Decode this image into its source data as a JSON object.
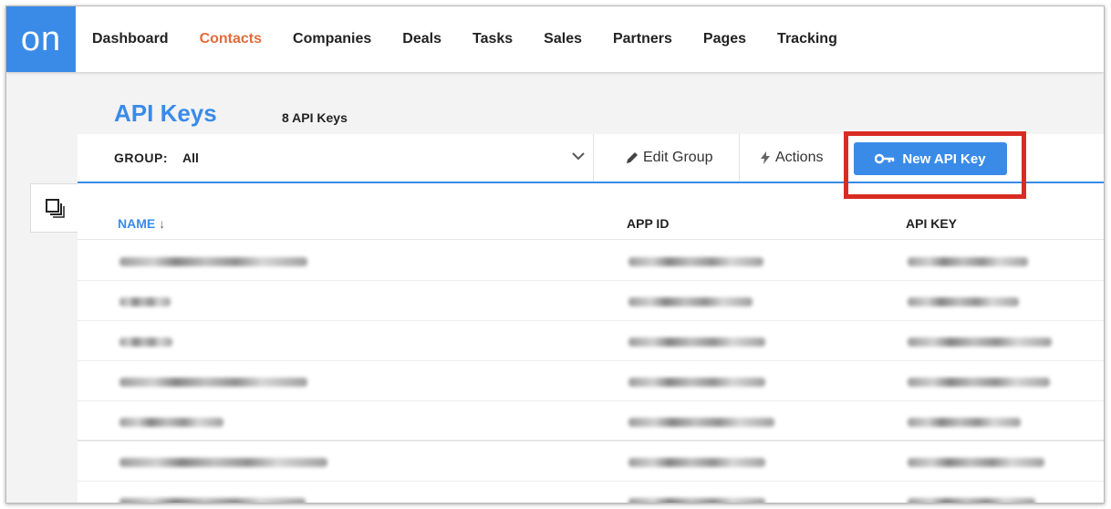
{
  "logo": {
    "text": "on"
  },
  "nav": {
    "items": [
      {
        "label": "Dashboard",
        "active": false
      },
      {
        "label": "Contacts",
        "active": true
      },
      {
        "label": "Companies",
        "active": false
      },
      {
        "label": "Deals",
        "active": false
      },
      {
        "label": "Tasks",
        "active": false
      },
      {
        "label": "Sales",
        "active": false
      },
      {
        "label": "Partners",
        "active": false
      },
      {
        "label": "Pages",
        "active": false
      },
      {
        "label": "Tracking",
        "active": false
      }
    ]
  },
  "page": {
    "title": "API Keys",
    "count": "8 API Keys"
  },
  "toolbar": {
    "group_label": "GROUP:",
    "group_value": "All",
    "edit_group": "Edit Group",
    "actions": "Actions",
    "new_api_key": "New API Key"
  },
  "table": {
    "columns": {
      "name": "NAME",
      "sort_indicator": "↓",
      "app_id": "APP ID",
      "api_key": "API KEY"
    }
  },
  "colors": {
    "accent": "#3a8be8",
    "active_nav": "#e26b3a",
    "highlight": "#d82c22"
  },
  "icons": [
    "layers-icon",
    "chevron-down-icon",
    "pencil-icon",
    "bolt-icon",
    "key-icon"
  ]
}
